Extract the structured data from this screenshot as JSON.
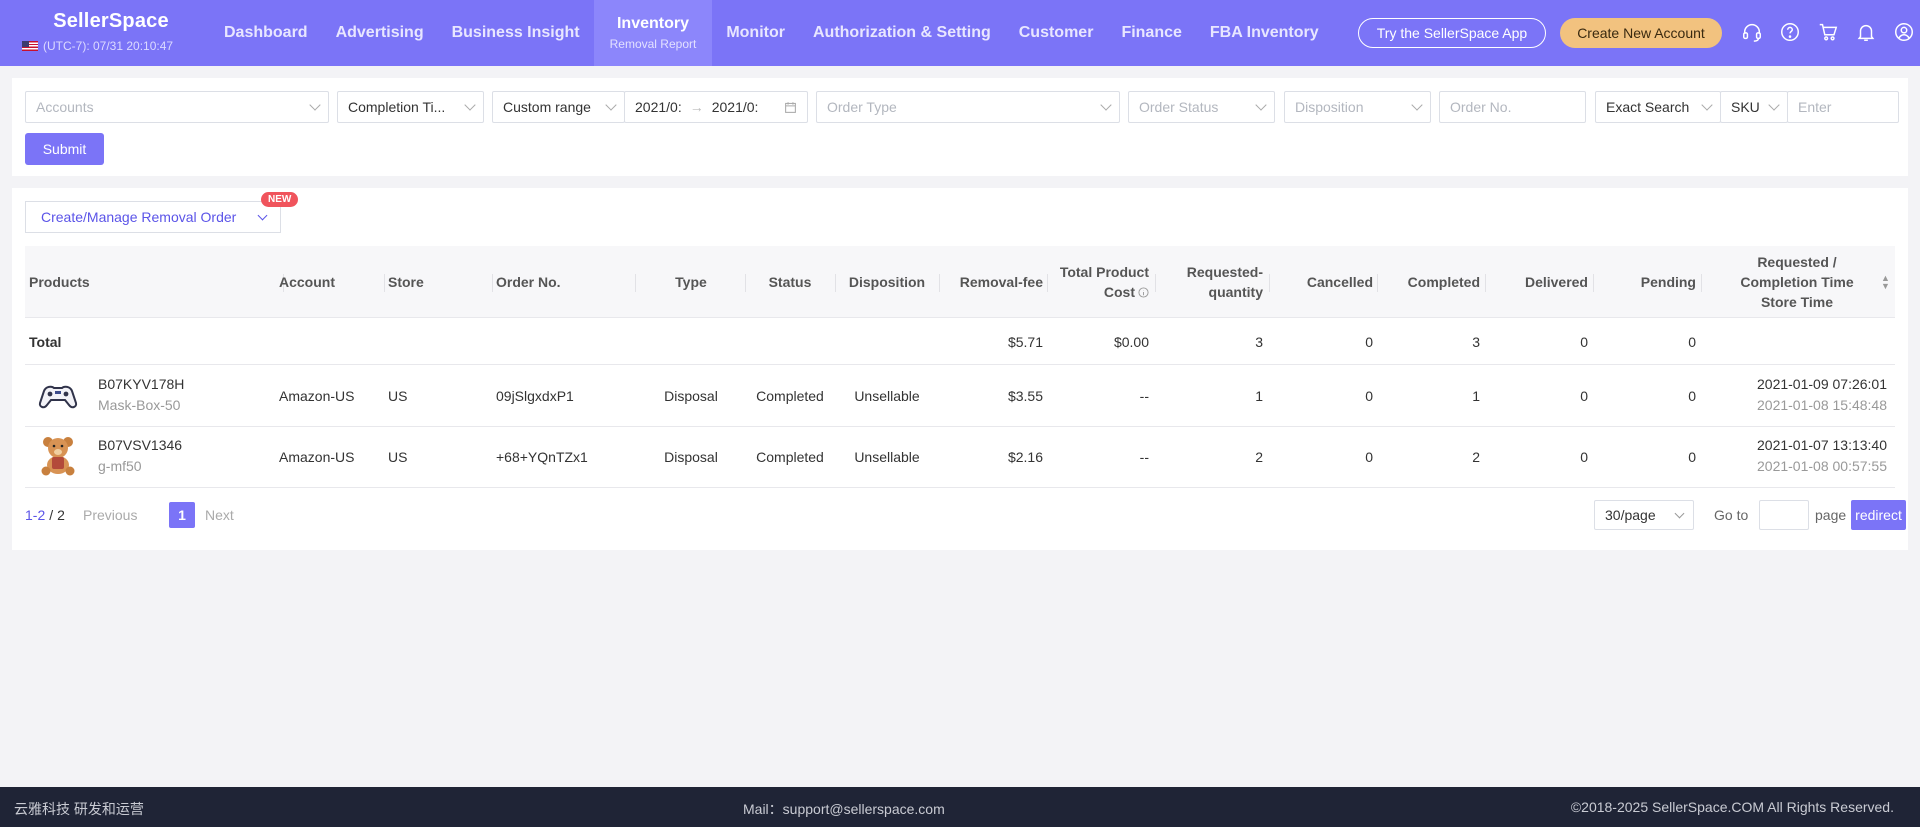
{
  "header": {
    "brand": "SellerSpace",
    "time": "(UTC-7): 07/31 20:10:47",
    "nav": [
      {
        "label": "Dashboard"
      },
      {
        "label": "Advertising"
      },
      {
        "label": "Business Insight"
      },
      {
        "label": "Inventory",
        "sub": "Removal Report",
        "active": true
      },
      {
        "label": "Monitor"
      },
      {
        "label": "Authorization & Setting"
      },
      {
        "label": "Customer"
      },
      {
        "label": "Finance"
      },
      {
        "label": "FBA Inventory"
      }
    ],
    "try_app": "Try the SellerSpace App",
    "create_account": "Create New Account",
    "icons": [
      "headset-icon",
      "help-icon",
      "cart-icon",
      "bell-icon",
      "user-icon"
    ]
  },
  "filters": {
    "accounts_placeholder": "Accounts",
    "time_type": "Completion Ti...",
    "range_type": "Custom range",
    "date_start": "2021/0:",
    "date_end": "2021/0:",
    "order_type_placeholder": "Order Type",
    "order_status_placeholder": "Order Status",
    "disposition_placeholder": "Disposition",
    "order_no_placeholder": "Order No.",
    "search_mode": "Exact Search",
    "search_field": "SKU",
    "search_placeholder": "Enter",
    "submit": "Submit"
  },
  "table": {
    "manage_button": "Create/Manage Removal Order",
    "new_badge": "NEW",
    "headers": {
      "products": "Products",
      "account": "Account",
      "store": "Store",
      "order_no": "Order No.",
      "type": "Type",
      "status": "Status",
      "disposition": "Disposition",
      "removal_fee": "Removal-fee",
      "total_cost_1": "Total Product",
      "total_cost_2": "Cost",
      "req_qty_1": "Requested-",
      "req_qty_2": "quantity",
      "cancelled": "Cancelled",
      "completed": "Completed",
      "delivered": "Delivered",
      "pending": "Pending",
      "time_1": "Requested /",
      "time_2": "Completion Time",
      "time_3": "Store Time"
    },
    "total": {
      "label": "Total",
      "removal_fee": "$5.71",
      "total_cost": "$0.00",
      "requested": "3",
      "cancelled": "0",
      "completed": "3",
      "delivered": "0",
      "pending": "0"
    },
    "rows": [
      {
        "asin": "B07KYV178H",
        "sku": "Mask-Box-50",
        "thumb_icon": "gamepad-icon",
        "account": "Amazon-US",
        "store": "US",
        "order_no": "09jSlgxdxP1",
        "type": "Disposal",
        "status": "Completed",
        "disposition": "Unsellable",
        "removal_fee": "$3.55",
        "total_cost": "--",
        "requested": "1",
        "cancelled": "0",
        "completed": "1",
        "delivered": "0",
        "pending": "0",
        "time": "2021-01-09 07:26:01",
        "store_time": "2021-01-08 15:48:48"
      },
      {
        "asin": "B07VSV1346",
        "sku": "g-mf50",
        "thumb_icon": "teddy-bear-icon",
        "account": "Amazon-US",
        "store": "US",
        "order_no": "+68+YQnTZx1",
        "type": "Disposal",
        "status": "Completed",
        "disposition": "Unsellable",
        "removal_fee": "$2.16",
        "total_cost": "--",
        "requested": "2",
        "cancelled": "0",
        "completed": "2",
        "delivered": "0",
        "pending": "0",
        "time": "2021-01-07 13:13:40",
        "store_time": "2021-01-08 00:57:55"
      }
    ]
  },
  "pagination": {
    "range": "1-2",
    "slash": "/",
    "total": "2",
    "previous": "Previous",
    "current": "1",
    "next": "Next",
    "page_size": "30/page",
    "goto_label": "Go to",
    "page_label": "page",
    "redirect": "redirect"
  },
  "footer": {
    "left": "云雅科技 研发和运营",
    "mail": "Mail：support@sellerspace.com",
    "copyright": "©2018-2025 SellerSpace.COM All Rights Reserved."
  },
  "colors": {
    "accent": "#7b74f7",
    "footer": "#1f2436",
    "new_button": "#f2c27f"
  }
}
